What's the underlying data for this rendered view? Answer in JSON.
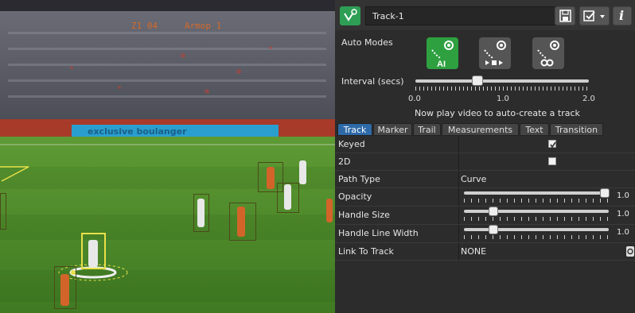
{
  "scoreboard": {
    "left": "Z1 04",
    "middle": "Armop 1"
  },
  "ad_board_text": "exclusive boulanger",
  "track": {
    "title": "Track-1"
  },
  "toolbar": {
    "save_icon": "save-icon",
    "check_icon": "checkbox-icon",
    "dropdown_icon": "chevron-down-icon",
    "info_label": "i"
  },
  "auto_modes": {
    "label": "Auto Modes",
    "buttons": [
      {
        "name": "ai-mode",
        "label": "AI",
        "active": true
      },
      {
        "name": "play-mode",
        "label": "",
        "active": false
      },
      {
        "name": "link-mode",
        "label": "",
        "active": false
      }
    ]
  },
  "interval": {
    "label": "Interval (secs)",
    "value": 0.65,
    "min_label": "0.0",
    "mid_label": "1.0",
    "max_label": "2.0",
    "hint": "Now play video to auto-create a track"
  },
  "tabs": [
    {
      "label": "Track",
      "selected": true
    },
    {
      "label": "Marker",
      "selected": false
    },
    {
      "label": "Trail",
      "selected": false
    },
    {
      "label": "Measurements",
      "selected": false
    },
    {
      "label": "Text",
      "selected": false
    },
    {
      "label": "Transition",
      "selected": false
    }
  ],
  "properties": {
    "keyed": {
      "label": "Keyed",
      "checked": true
    },
    "two_d": {
      "label": "2D",
      "checked": false
    },
    "path_type": {
      "label": "Path Type",
      "value": "Curve"
    },
    "opacity": {
      "label": "Opacity",
      "value": "1.0",
      "level": 1.0
    },
    "handle_size": {
      "label": "Handle Size",
      "value": "1.0",
      "level": 0.2
    },
    "handle_line_width": {
      "label": "Handle Line Width",
      "value": "1.0",
      "level": 0.2
    },
    "link_to_track": {
      "label": "Link To Track",
      "value": "NONE"
    }
  },
  "colors": {
    "accent_green": "#2ea040",
    "selected_tab": "#2e6aa8",
    "track_yellow": "#e8e04a"
  }
}
